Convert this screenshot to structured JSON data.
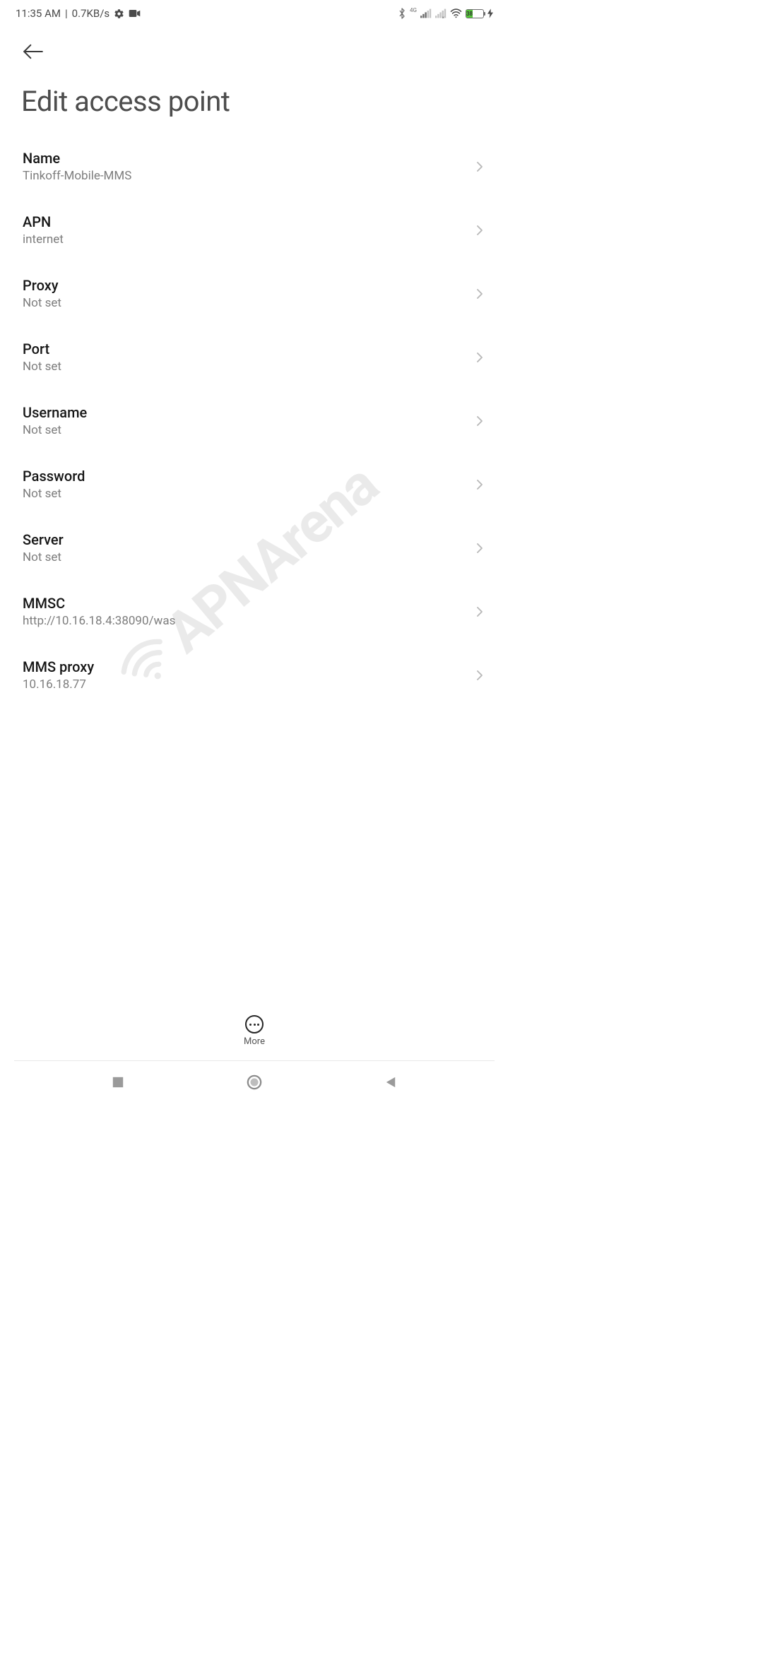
{
  "status_bar": {
    "time": "11:35 AM",
    "net_speed": "0.7KB/s",
    "network_label": "4G",
    "battery_percent": "38"
  },
  "header": {
    "title": "Edit access point"
  },
  "settings": [
    {
      "label": "Name",
      "value": "Tinkoff-Mobile-MMS"
    },
    {
      "label": "APN",
      "value": "internet"
    },
    {
      "label": "Proxy",
      "value": "Not set"
    },
    {
      "label": "Port",
      "value": "Not set"
    },
    {
      "label": "Username",
      "value": "Not set"
    },
    {
      "label": "Password",
      "value": "Not set"
    },
    {
      "label": "Server",
      "value": "Not set"
    },
    {
      "label": "MMSC",
      "value": "http://10.16.18.4:38090/was"
    },
    {
      "label": "MMS proxy",
      "value": "10.16.18.77"
    }
  ],
  "bottom_action": {
    "label": "More"
  },
  "watermark": {
    "text": "APNArena"
  }
}
